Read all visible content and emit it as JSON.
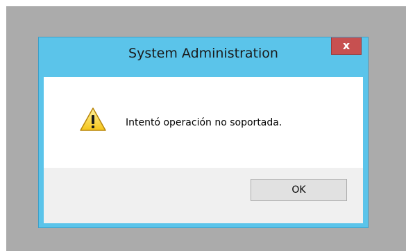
{
  "dialog": {
    "title": "System Administration",
    "close_glyph": "x",
    "icon": "warning-icon",
    "message": "Intentó operación no soportada.",
    "ok_label": "OK"
  },
  "colors": {
    "frame": "#5bc4ea",
    "close": "#c75050",
    "desktop": "#ababab",
    "footer": "#f0f0f0"
  }
}
